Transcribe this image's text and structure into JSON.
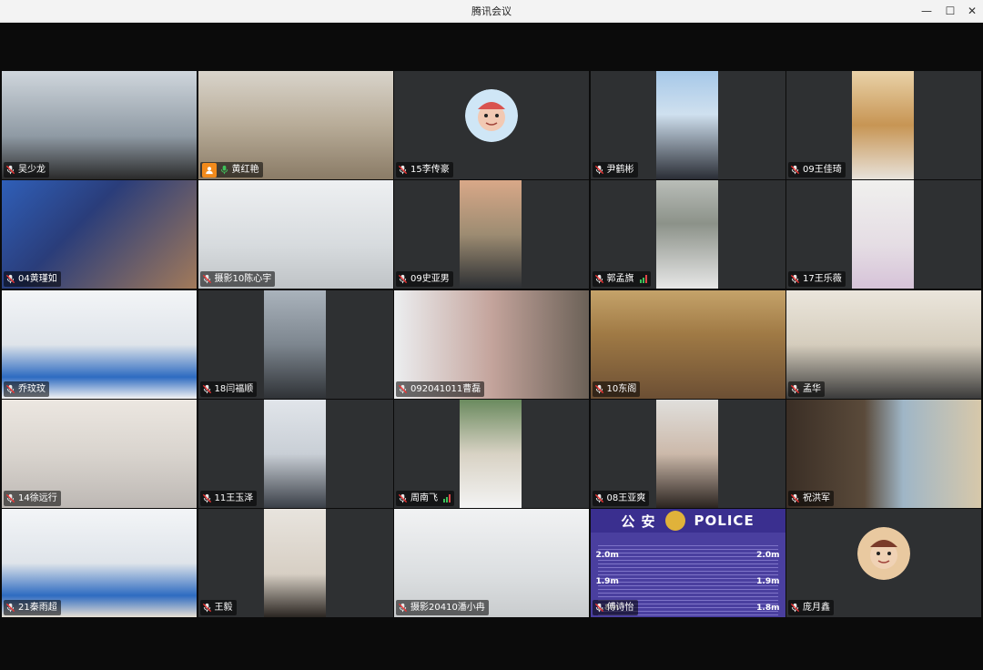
{
  "window": {
    "title": "腾讯会议",
    "minimize": "—",
    "maximize": "☐",
    "close": "✕"
  },
  "colors": {
    "active_border": "#2fbf4a",
    "tile_bg": "#2e3032",
    "host_badge": "#f28a1b"
  },
  "participants": [
    {
      "name": "吴少龙",
      "mic": "muted"
    },
    {
      "name": "黄红艳",
      "mic": "on",
      "host": true,
      "active": true
    },
    {
      "name": "15李传豪",
      "mic": "muted",
      "avatar": "cartoon-avatar"
    },
    {
      "name": "尹鹤彬",
      "mic": "muted"
    },
    {
      "name": "09王佳琦",
      "mic": "muted"
    },
    {
      "name": "04黄瑾如",
      "mic": "muted"
    },
    {
      "name": "摄影10陈心宇",
      "mic": "muted"
    },
    {
      "name": "09史亚男",
      "mic": "muted"
    },
    {
      "name": "郭孟旗",
      "mic": "muted",
      "signal": true
    },
    {
      "name": "17王乐薇",
      "mic": "muted"
    },
    {
      "name": "乔玟玟",
      "mic": "muted"
    },
    {
      "name": "18闫福顺",
      "mic": "muted"
    },
    {
      "name": "092041011曹磊",
      "mic": "muted"
    },
    {
      "name": "10东阁",
      "mic": "muted"
    },
    {
      "name": "孟华",
      "mic": "muted"
    },
    {
      "name": "14徐远行",
      "mic": "muted"
    },
    {
      "name": "11王玉泽",
      "mic": "muted"
    },
    {
      "name": "周南飞",
      "mic": "muted",
      "signal": true
    },
    {
      "name": "08王亚爽",
      "mic": "muted"
    },
    {
      "name": "祝洪军",
      "mic": "muted"
    },
    {
      "name": "21秦雨超",
      "mic": "muted"
    },
    {
      "name": "王毅",
      "mic": "muted"
    },
    {
      "name": "摄影20410潘小冉",
      "mic": "muted"
    },
    {
      "name": "傅诗怡",
      "mic": "muted"
    },
    {
      "name": "庞月鑫",
      "mic": "muted",
      "avatar": "cartoon-avatar"
    }
  ],
  "police_backdrop": {
    "left_text": "公 安",
    "right_text": "POLICE",
    "heights": [
      "2.0m",
      "1.9m",
      "1.8m"
    ]
  }
}
